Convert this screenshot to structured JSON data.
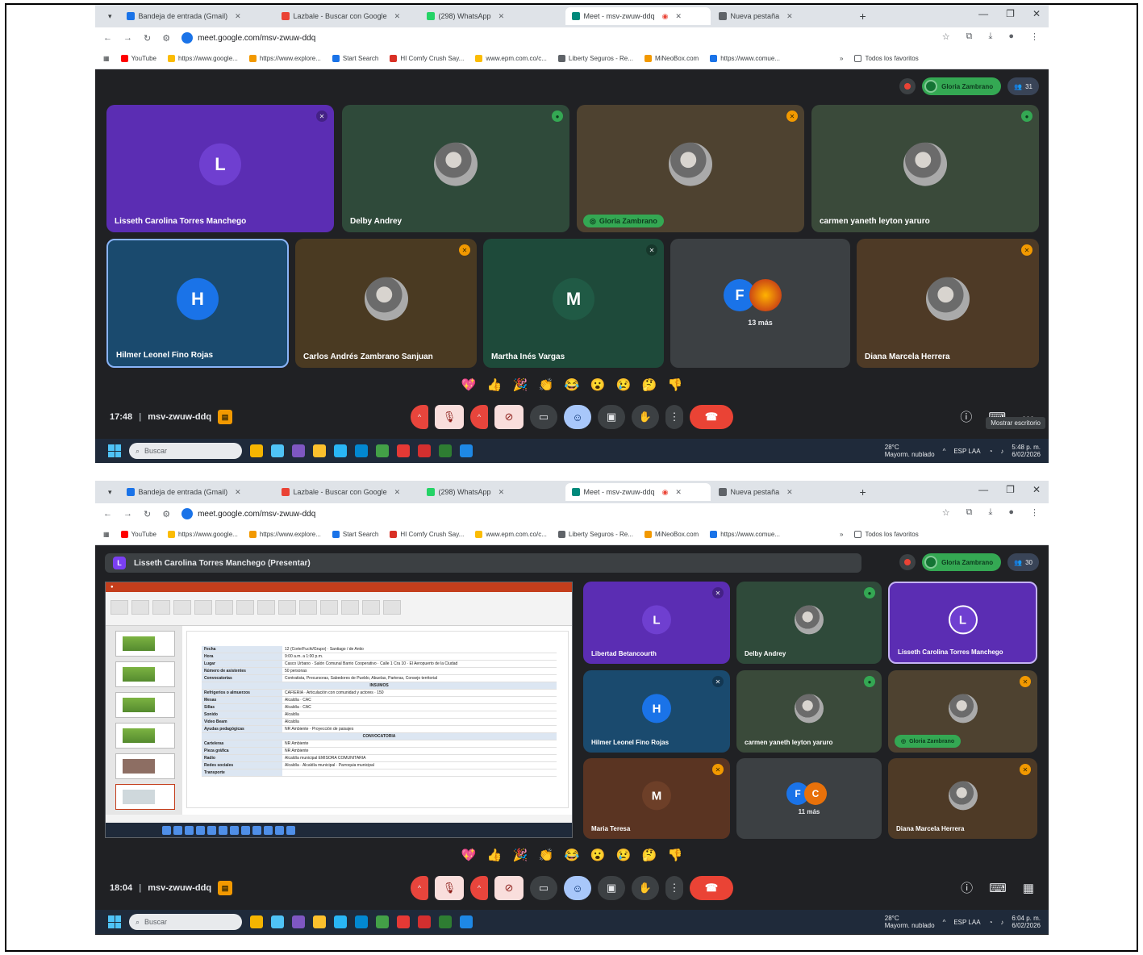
{
  "browser": {
    "tabs": [
      "Bandeja de entrada (Gmail)",
      "Lazbale - Buscar con Google",
      "(298) WhatsApp",
      "Meet - msv-zwuw-ddq",
      "Nueva pestaña"
    ],
    "url": "meet.google.com/msv-zwuw-ddq",
    "bookmarks": [
      "YouTube",
      "https://www.google...",
      "https://www.explore...",
      "Start Search",
      "HI Comfy Crush Say...",
      "www.epm.com.co/c...",
      "Liberty Seguros - Re...",
      "MiNeoBox.com",
      "https://www.comue..."
    ],
    "bookmarks_folder": "Todos los favoritos",
    "colors": {
      "tabbar": "#dfe3e8"
    }
  },
  "shot1": {
    "presenter_badge": "Gloria Zambrano",
    "people_count": "31",
    "tiles": [
      {
        "name": "Lisseth Carolina Torres Manchego",
        "initial": "L"
      },
      {
        "name": "Delby Andrey",
        "initial": ""
      },
      {
        "name": "Gloria Zambrano",
        "initial": ""
      },
      {
        "name": "carmen yaneth leyton yaruro",
        "initial": ""
      },
      {
        "name": "Hilmer Leonel Fino Rojas",
        "initial": "H"
      },
      {
        "name": "Carlos Andrés Zambrano Sanjuan",
        "initial": ""
      },
      {
        "name": "Martha Inés Vargas",
        "initial": "M"
      },
      {
        "name": "13 más",
        "initial": "F"
      },
      {
        "name": "Diana Marcela Herrera",
        "initial": ""
      }
    ],
    "time": "17:48",
    "meeting_code": "msv-zwuw-ddq",
    "tooltip": "Mostrar escritorio"
  },
  "shot2": {
    "present_title": "Lisseth Carolina Torres Manchego (Presentar)",
    "presenter_badge": "Gloria Zambrano",
    "people_count": "30",
    "tiles": [
      {
        "name": "Libertad Betancourth",
        "initial": "L"
      },
      {
        "name": "Delby Andrey",
        "initial": ""
      },
      {
        "name": "Lisseth Carolina Torres Manchego",
        "initial": "L"
      },
      {
        "name": "Hilmer Leonel Fino Rojas",
        "initial": "H"
      },
      {
        "name": "carmen yaneth leyton yaruro",
        "initial": ""
      },
      {
        "name": "Gloria Zambrano",
        "initial": ""
      },
      {
        "name": "Maria Teresa",
        "initial": "M"
      },
      {
        "name": "11 más",
        "initial": "F"
      },
      {
        "name": "Diana Marcela Herrera",
        "initial": ""
      }
    ],
    "time": "18:04",
    "meeting_code": "msv-zwuw-ddq",
    "slide_rows": [
      {
        "k": "Fecha",
        "v": "12 (Corte/Fuchi/Grupo) · Santiago / de Antio"
      },
      {
        "k": "Hora",
        "v": "9:00 a.m. a 1:00 p.m."
      },
      {
        "k": "Lugar",
        "v": "Casco Urbano · Salón Comunal Barrio Cooperativo · Calle 1 Cra 10 · El Aeropuerto de la Ciudad"
      },
      {
        "k": "Número de asistentes",
        "v": "50 personas"
      },
      {
        "k": "Convocatorias",
        "v": "Contratista, Precursoras, Sabedores de Pueblo, Abuelas, Parteras, Consejo territorial"
      },
      {
        "k": "",
        "v": "INSUMOS"
      },
      {
        "k": "Refrigerios o almuerzos",
        "v": "CAFIERIA · Articulación con comunidad y actores · 150"
      },
      {
        "k": "Mesas",
        "v": "Alcaldía · CAC"
      },
      {
        "k": "Sillas",
        "v": "Alcaldía · CAC"
      },
      {
        "k": "Sonido",
        "v": "Alcaldía"
      },
      {
        "k": "Video Beam",
        "v": "Alcaldía"
      },
      {
        "k": "Ayudas pedagógicas",
        "v": "NR Ambiente · Proyección de paisajes"
      },
      {
        "k": "",
        "v": "CONVOCATORIA"
      },
      {
        "k": "Carteleras",
        "v": "NR Ambiente"
      },
      {
        "k": "Pieza gráfica",
        "v": "NR Ambiente"
      },
      {
        "k": "Radio",
        "v": "Alcaldía municipal EMISORA COMUNITARIA"
      },
      {
        "k": "Redes sociales",
        "v": "Alcaldía · Alcaldía municipal · Parroquia municipal"
      },
      {
        "k": "Transporte",
        "v": ""
      }
    ]
  },
  "reactions": [
    "💖",
    "👍",
    "🎉",
    "👏",
    "😂",
    "😮",
    "😢",
    "🤔",
    "👎"
  ],
  "taskbar": {
    "search_placeholder": "Buscar",
    "weather_temp": "28°C",
    "weather_text": "Mayorm. nublado",
    "lang": "ESP LAA",
    "clock_time_1": "5:48 p. m.",
    "clock_time_2": "6:04 p. m.",
    "clock_date": "6/02/2026"
  }
}
